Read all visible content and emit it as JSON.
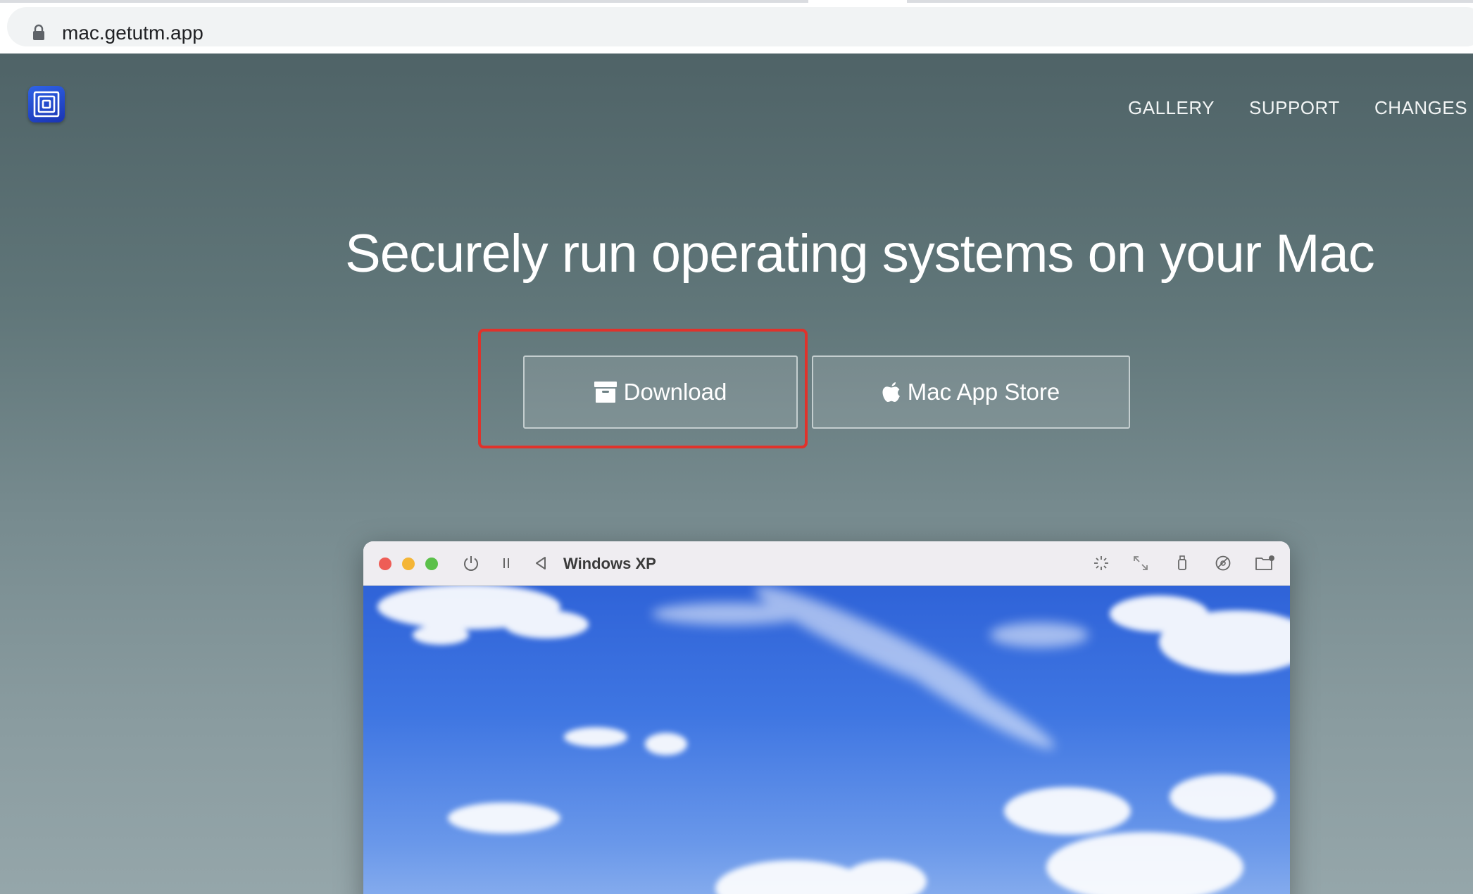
{
  "browser": {
    "url": "mac.getutm.app"
  },
  "nav": {
    "items": [
      {
        "label": "GALLERY"
      },
      {
        "label": "SUPPORT"
      },
      {
        "label": "CHANGES"
      }
    ]
  },
  "hero": {
    "title": "Securely run operating systems on your Mac",
    "download_label": "Download",
    "appstore_label": "Mac App Store"
  },
  "vm_window": {
    "title": "Windows XP"
  },
  "colors": {
    "highlight": "#e0322b",
    "page_gradient_top": "#4f6367",
    "page_gradient_bottom": "#95a6aa",
    "xp_sky": "#3f76e2"
  },
  "icons": {
    "lock": "lock-icon",
    "download": "archive-box-icon",
    "appstore": "apple-logo-icon",
    "power": "power-icon",
    "pause": "pause-icon",
    "back": "triangle-left-icon",
    "capture": "cursor-capture-icon",
    "resize": "resize-icon",
    "usb": "usb-icon",
    "drive": "drive-icon",
    "shared_folder": "shared-folder-icon"
  }
}
